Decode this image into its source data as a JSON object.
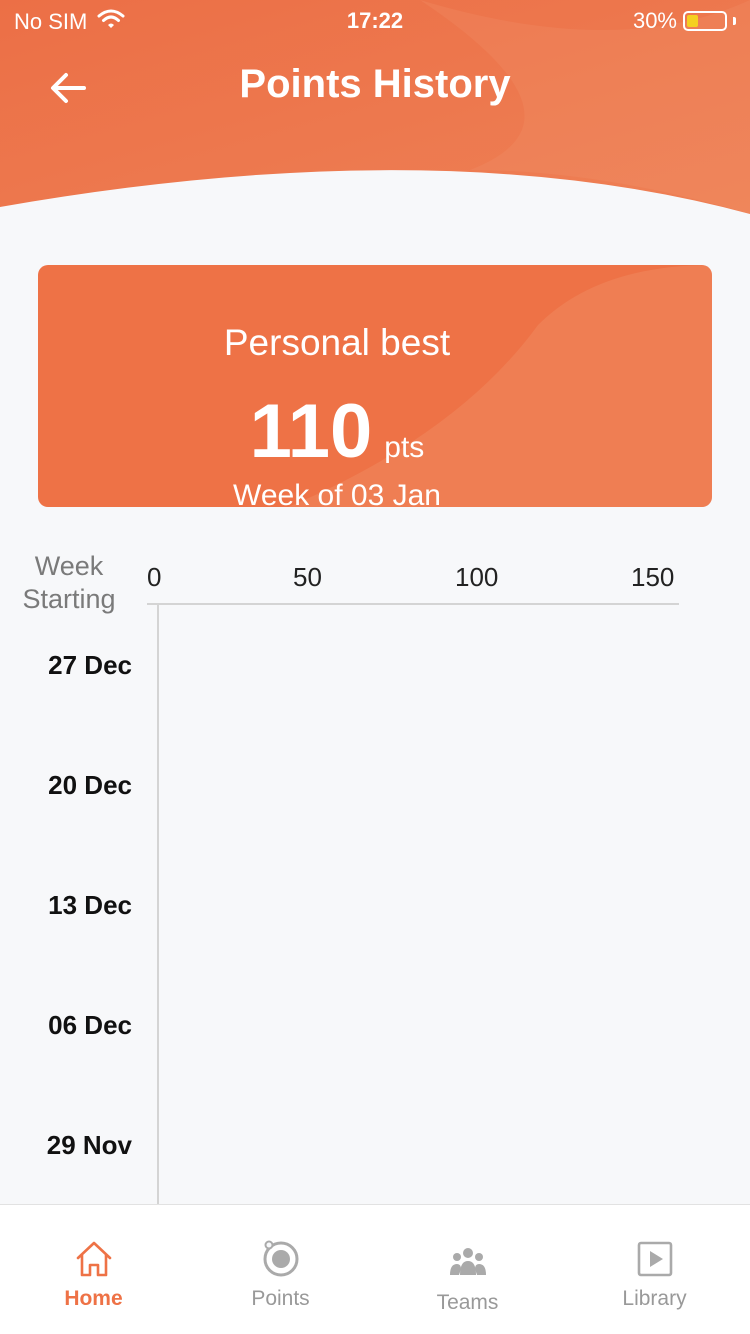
{
  "status_bar": {
    "carrier": "No SIM",
    "time": "17:22",
    "battery_percent": "30%",
    "battery_level": 0.3,
    "wifi_icon": "wifi-icon",
    "battery_icon": "battery-icon"
  },
  "header": {
    "title": "Points History",
    "back_icon": "arrow-left-icon"
  },
  "colors": {
    "accent": "#ee7246",
    "background": "#f7f8fa",
    "battery_fill": "#f5d020"
  },
  "personal_best": {
    "title": "Personal best",
    "value": "110",
    "unit": "pts",
    "week": "Week of 03 Jan"
  },
  "chart": {
    "axis_title": "Week Starting",
    "x_ticks": [
      "0",
      "50",
      "100",
      "150"
    ],
    "y_ticks": [
      "27 Dec",
      "20 Dec",
      "13 Dec",
      "06 Dec",
      "29 Nov"
    ]
  },
  "tab_bar": {
    "tabs": [
      {
        "label": "Home",
        "icon": "home-icon",
        "active": true
      },
      {
        "label": "Points",
        "icon": "points-icon",
        "active": false
      },
      {
        "label": "Teams",
        "icon": "teams-icon",
        "active": false
      },
      {
        "label": "Library",
        "icon": "library-icon",
        "active": false
      }
    ]
  }
}
